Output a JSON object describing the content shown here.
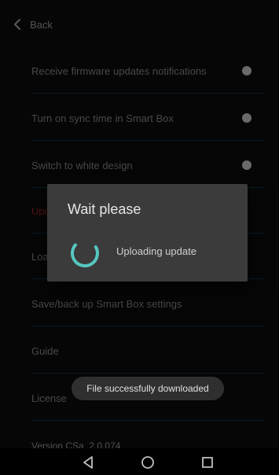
{
  "header": {
    "back_label": "Back"
  },
  "settings": {
    "items": [
      {
        "label": "Receive firmware updates notifications",
        "has_toggle": true
      },
      {
        "label": "Turn on sync time in Smart Box",
        "has_toggle": true
      },
      {
        "label": "Switch to white design",
        "has_toggle": true
      },
      {
        "label": "Upd",
        "has_toggle": false,
        "accent": "#8a1f1f"
      },
      {
        "label": "Loa",
        "has_toggle": false
      },
      {
        "label": "Save/back up Smart Box settings",
        "has_toggle": false
      },
      {
        "label": "Guide",
        "has_toggle": false
      },
      {
        "label": "License",
        "has_toggle": false
      }
    ],
    "version_text": "Version CSa_2.0.074"
  },
  "dialog": {
    "title": "Wait please",
    "message": "Uploading update",
    "spinner_color": "#56c7c1"
  },
  "toast": {
    "text": "File successfully downloaded"
  },
  "system_nav": {
    "items": [
      {
        "name": "back",
        "icon": "triangle-back-icon"
      },
      {
        "name": "home",
        "icon": "circle-home-icon"
      },
      {
        "name": "recents",
        "icon": "square-recents-icon"
      }
    ]
  },
  "colors": {
    "background": "#0a0a0a",
    "divider": "#0b2a3a",
    "text_muted": "#6f6f6f",
    "dialog_bg": "#3b3b3b",
    "toast_bg": "#2f2f2f"
  }
}
